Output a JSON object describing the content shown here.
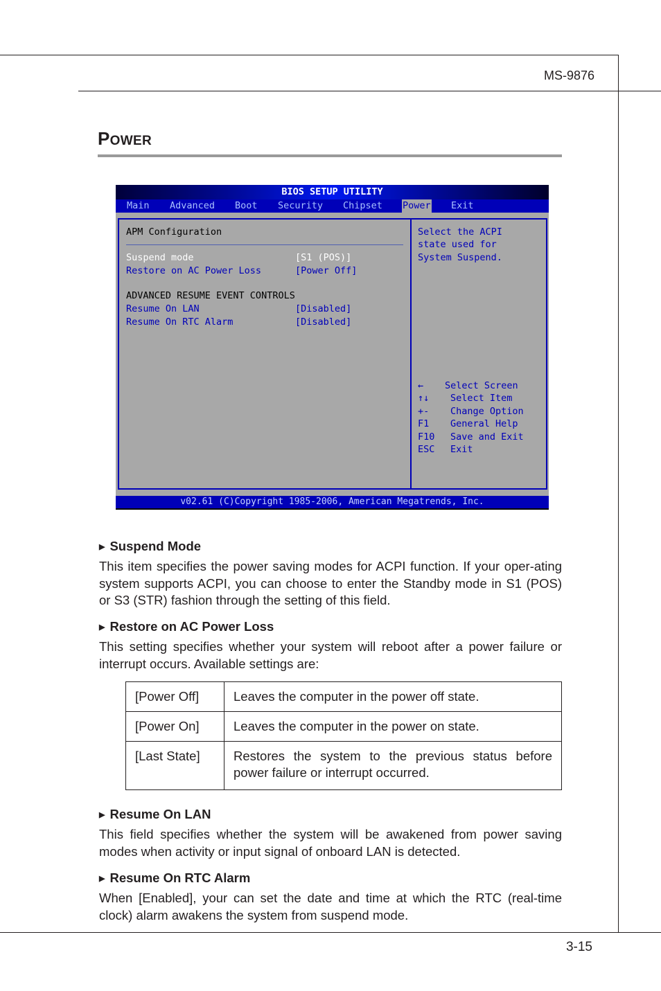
{
  "header": {
    "model": "MS-9876"
  },
  "footer": {
    "page_number": "3-15"
  },
  "section": {
    "title_first": "P",
    "title_rest": "OWER"
  },
  "bios": {
    "title": "BIOS SETUP UTILITY",
    "tabs": [
      {
        "label": "Main"
      },
      {
        "label": "Advanced"
      },
      {
        "label": "Boot"
      },
      {
        "label": "Security"
      },
      {
        "label": "Chipset"
      },
      {
        "label": "Power",
        "active": true
      },
      {
        "label": "Exit"
      }
    ],
    "panel_heading": "APM Configuration",
    "items": [
      {
        "label": "Suspend mode",
        "value": "[S1 (POS)]",
        "selected": true
      },
      {
        "label": "Restore on AC Power Loss",
        "value": "[Power Off]"
      }
    ],
    "group_heading": "ADVANCED RESUME EVENT CONTROLS",
    "group_items": [
      {
        "label": "Resume On LAN",
        "value": "[Disabled]"
      },
      {
        "label": "Resume On RTC Alarm",
        "value": "[Disabled]"
      }
    ],
    "help_lines": [
      "Select the ACPI",
      "state used for",
      "System Suspend."
    ],
    "keys": [
      {
        "key": "←",
        "action": "Select Screen"
      },
      {
        "key": "↑↓",
        "action": "Select Item"
      },
      {
        "key": "+-",
        "action": "Change Option"
      },
      {
        "key": "F1",
        "action": "General Help"
      },
      {
        "key": "F10",
        "action": "Save and Exit"
      },
      {
        "key": "ESC",
        "action": "Exit"
      }
    ],
    "copyright": "v02.61 (C)Copyright 1985-2006, American Megatrends, Inc."
  },
  "sections": [
    {
      "heading": "Suspend Mode",
      "body": "This item specifies the power saving modes for ACPI function. If your oper-ating system supports ACPI, you can choose to enter the Standby mode in S1 (POS) or S3 (STR) fashion through the setting of this field."
    },
    {
      "heading": "Restore on AC Power Loss",
      "body": "This setting specifies whether your system will reboot after a power failure or interrupt occurs. Available settings are:"
    },
    {
      "heading": "Resume On LAN",
      "body": "This field specifies whether the system will be awakened from power saving modes when activity or input signal of onboard LAN is detected."
    },
    {
      "heading": "Resume On RTC Alarm",
      "body": "When [Enabled], your can set the date and time at which the RTC (real-time clock) alarm awakens the system from suspend mode."
    }
  ],
  "options_table": [
    {
      "option": "[Power Off]",
      "description": "Leaves the computer in the power off state."
    },
    {
      "option": "[Power On]",
      "description": "Leaves the computer in the power on state."
    },
    {
      "option": "[Last State]",
      "description": "Restores the system to the previous status before power failure or interrupt occurred."
    }
  ]
}
